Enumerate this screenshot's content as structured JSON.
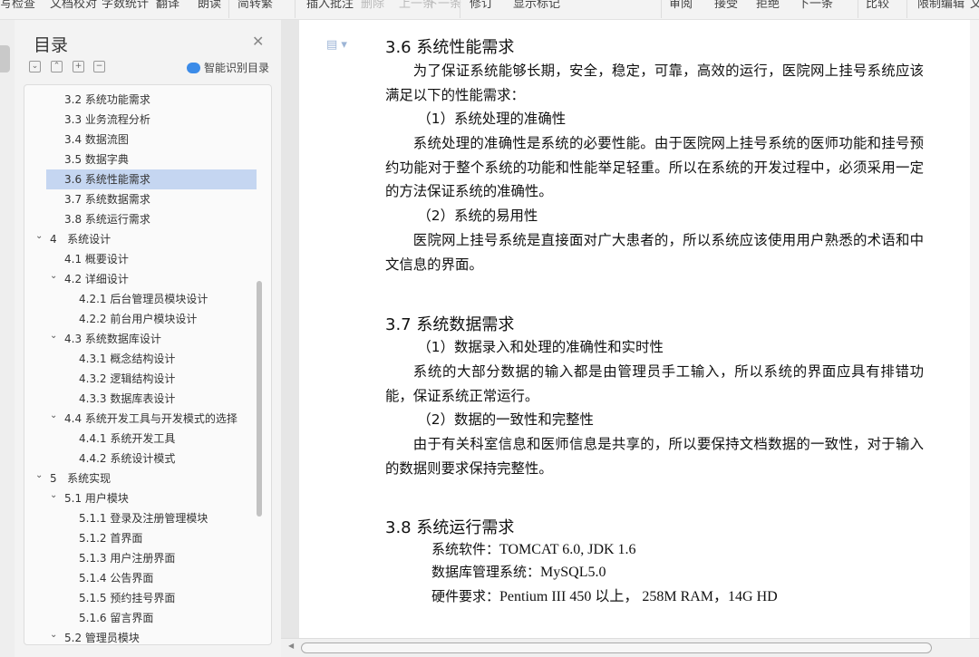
{
  "toolbar": {
    "items": [
      "写检查",
      "文档校对",
      "字数统计",
      "翻译",
      "朗读",
      "简转繁",
      "插入批注",
      "删除",
      "上一条",
      "下一条",
      "修订",
      "显示标记",
      "审阅",
      "接受",
      "拒绝",
      "下一条",
      "比较",
      "限制编辑",
      "文"
    ]
  },
  "sidebar": {
    "title": "目录",
    "smart_label": "智能识别目录",
    "controls": [
      "collapse",
      "expand",
      "add",
      "remove"
    ],
    "items": [
      {
        "label": "3.2 系统功能需求",
        "level": 2
      },
      {
        "label": "3.3 业务流程分析",
        "level": 2
      },
      {
        "label": "3.4 数据流图",
        "level": 2
      },
      {
        "label": "3.5 数据字典",
        "level": 2
      },
      {
        "label": "3.6 系统性能需求",
        "level": 2,
        "selected": true
      },
      {
        "label": "3.7 系统数据需求",
        "level": 2
      },
      {
        "label": "3.8 系统运行需求",
        "level": 2
      },
      {
        "label": "4   系统设计",
        "level": 1,
        "expanded": true
      },
      {
        "label": "4.1 概要设计",
        "level": 2
      },
      {
        "label": "4.2 详细设计",
        "level": 2,
        "expanded": true
      },
      {
        "label": "4.2.1 后台管理员模块设计",
        "level": 3
      },
      {
        "label": "4.2.2 前台用户模块设计",
        "level": 3
      },
      {
        "label": "4.3 系统数据库设计",
        "level": 2,
        "expanded": true
      },
      {
        "label": "4.3.1 概念结构设计",
        "level": 3
      },
      {
        "label": "4.3.2 逻辑结构设计",
        "level": 3
      },
      {
        "label": "4.3.3 数据库表设计",
        "level": 3
      },
      {
        "label": "4.4 系统开发工具与开发模式的选择",
        "level": 2,
        "expanded": true
      },
      {
        "label": "4.4.1 系统开发工具",
        "level": 3
      },
      {
        "label": "4.4.2 系统设计模式",
        "level": 3
      },
      {
        "label": "5   系统实现",
        "level": 1,
        "expanded": true
      },
      {
        "label": "5.1 用户模块",
        "level": 2,
        "expanded": true
      },
      {
        "label": "5.1.1 登录及注册管理模块",
        "level": 3
      },
      {
        "label": "5.1.2 首界面",
        "level": 3
      },
      {
        "label": "5.1.3 用户注册界面",
        "level": 3
      },
      {
        "label": "5.1.4 公告界面",
        "level": 3
      },
      {
        "label": "5.1.5 预约挂号界面",
        "level": 3
      },
      {
        "label": "5.1.6 留言界面",
        "level": 3
      },
      {
        "label": "5.2 管理员模块",
        "level": 2,
        "expanded": true
      }
    ]
  },
  "document": {
    "h36": "3.6 系统性能需求",
    "p1": "为了保证系统能够长期，安全，稳定，可靠，高效的运行，医院网上挂号系统应该满足以下的性能需求：",
    "p2": "（1）系统处理的准确性",
    "p3": "系统处理的准确性是系统的必要性能。由于医院网上挂号系统的医师功能和挂号预约功能对于整个系统的功能和性能举足轻重。所以在系统的开发过程中，必须采用一定的方法保证系统的准确性。",
    "p4": "（2）系统的易用性",
    "p5": "医院网上挂号系统是直接面对广大患者的，所以系统应该使用用户熟悉的术语和中文信息的界面。",
    "h37": "3.7 系统数据需求",
    "p6": "（1）数据录入和处理的准确性和实时性",
    "p7": "系统的大部分数据的输入都是由管理员手工输入，所以系统的界面应具有排错功能，保证系统正常运行。",
    "p8": "（2）数据的一致性和完整性",
    "p9": "由于有关科室信息和医师信息是共享的，所以要保持文档数据的一致性，对于输入的数据则要求保持完整性。",
    "h38": "3.8 系统运行需求",
    "r1_label": "系统软件：",
    "r1_value": "TOMCAT 6.0, JDK 1.6",
    "r2_label": "数据库管理系统：",
    "r2_value": "MySQL5.0",
    "r3_label": "硬件要求：",
    "r3_value": "Pentium III 450 以上，   258M RAM，14G HD"
  }
}
